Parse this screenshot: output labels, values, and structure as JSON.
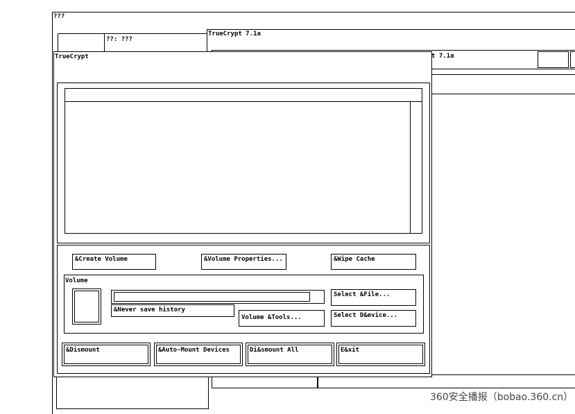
{
  "desktop": {
    "title": "???"
  },
  "bg_tab": {
    "label": "??: ???"
  },
  "bg_window": {
    "title": "TrueCrypt 7.1a",
    "title_partial": "t 7.1a"
  },
  "main_window": {
    "title": "TrueCrypt",
    "buttons": {
      "create_volume": "&Create Volume",
      "volume_properties": "&Volume Properties...",
      "wipe_cache": "&Wipe Cache"
    },
    "volume_group": {
      "label": "Volume",
      "volume_path": "",
      "never_save_history": "&Never save history",
      "select_file": "Select &File...",
      "volume_tools": "Volume &Tools...",
      "select_device": "Select D&evice..."
    },
    "bottom_buttons": {
      "dismount": "&Dismount",
      "auto_mount": "&Auto-Mount Devices",
      "dismount_all": "Di&smount All",
      "exit": "E&xit"
    }
  },
  "watermark": {
    "text": "360安全播报（bobao.360.cn）"
  }
}
